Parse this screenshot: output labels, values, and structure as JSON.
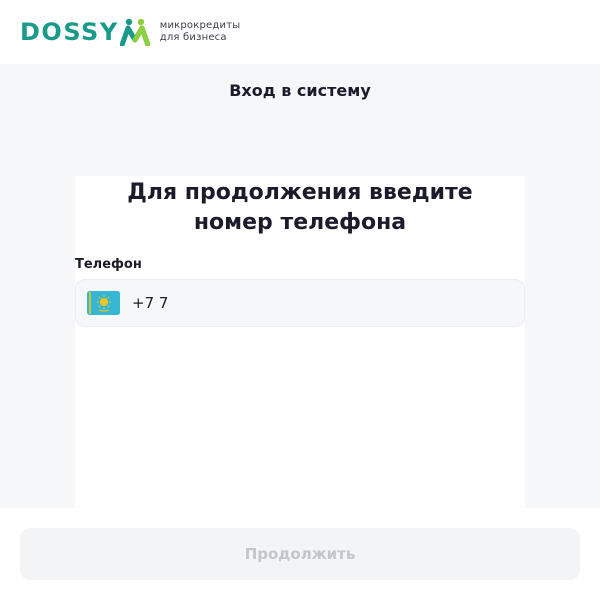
{
  "header": {
    "logo_text": "DOSSYM",
    "logo_word": "DOSSY",
    "tagline_line1": "микрокредиты",
    "tagline_line2": "для бизнеса",
    "brand_color": "#1a9a8a"
  },
  "page": {
    "heading": "Вход в систему"
  },
  "form": {
    "title_line1": "Для продолжения введите",
    "title_line2": "номер телефона",
    "phone_label": "Телефон",
    "phone_value": "+7 7",
    "country_flag_icon": "kazakhstan-flag-icon",
    "flag_color": "#35b7d4"
  },
  "footer": {
    "continue_label": "Продолжить",
    "continue_disabled": true
  }
}
